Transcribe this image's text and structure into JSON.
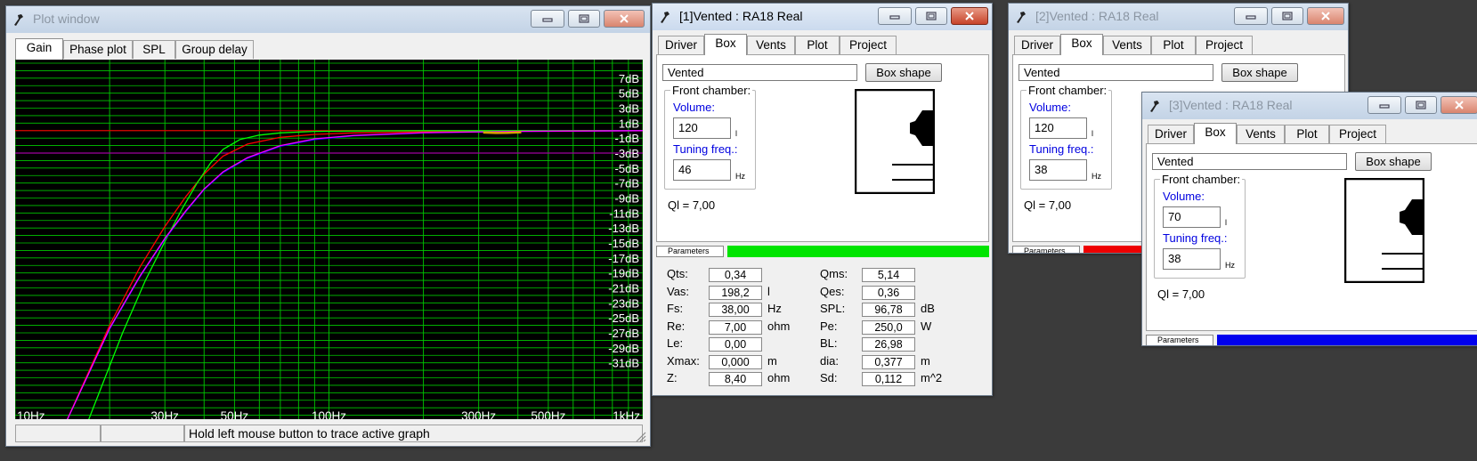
{
  "plot_window": {
    "title": "Plot window",
    "tabs": [
      "Gain",
      "Phase plot",
      "SPL",
      "Group delay"
    ],
    "selected_tab": "Gain",
    "status": "Hold left mouse button to trace active graph"
  },
  "chart_data": {
    "type": "line",
    "title": "",
    "xlabel": "",
    "ylabel": "",
    "x_scale": "log",
    "xlim": [
      10,
      1000
    ],
    "ylim": [
      -39,
      9
    ],
    "grid": true,
    "background": "#000000",
    "grid_color": "#00c800",
    "y_tick_labels": [
      "7dB",
      "5dB",
      "3dB",
      "1dB",
      "-1dB",
      "-3dB",
      "-5dB",
      "-7dB",
      "-9dB",
      "-11dB",
      "-13dB",
      "-15dB",
      "-17dB",
      "-19dB",
      "-21dB",
      "-23dB",
      "-25dB",
      "-27dB",
      "-29dB",
      "-31dB"
    ],
    "y_tick_values": [
      7,
      5,
      3,
      1,
      -1,
      -3,
      -5,
      -7,
      -9,
      -11,
      -13,
      -15,
      -17,
      -19,
      -21,
      -23,
      -25,
      -27,
      -29,
      -31
    ],
    "x_tick_labels": [
      "10Hz",
      "30Hz",
      "50Hz",
      "100Hz",
      "300Hz",
      "500Hz",
      "1kHz"
    ],
    "x_tick_values": [
      10,
      30,
      50,
      100,
      300,
      500,
      1000
    ],
    "reference_lines": [
      {
        "y": 0,
        "color": "#e00000"
      },
      {
        "y": -3,
        "color": "#a000a0"
      }
    ],
    "series": [
      {
        "color": "#ff0000",
        "x": [
          14.5,
          20,
          25,
          30,
          35,
          40,
          46,
          55,
          70,
          90,
          120,
          200,
          400,
          1000
        ],
        "y": [
          -39,
          -26,
          -18.2,
          -12.8,
          -8.8,
          -5.8,
          -3.4,
          -1.8,
          -0.9,
          -0.5,
          -0.3,
          -0.15,
          -0.05,
          0
        ]
      },
      {
        "color": "#00ff00",
        "x": [
          17,
          22,
          26,
          30,
          34,
          38,
          42,
          46,
          52,
          60,
          70,
          90,
          120,
          200,
          400,
          1000
        ],
        "y": [
          -39,
          -27,
          -20,
          -14.8,
          -10.5,
          -7,
          -4.3,
          -2.5,
          -1.2,
          -0.6,
          -0.3,
          -0.1,
          -0.05,
          0,
          0,
          0
        ]
      },
      {
        "color": "#0000ff",
        "x": [
          14.5,
          20,
          25,
          30,
          35,
          40,
          46,
          55,
          70,
          90,
          120,
          200,
          400,
          1000
        ],
        "y": [
          -39,
          -26.5,
          -19.5,
          -14.5,
          -10.8,
          -7.9,
          -5.6,
          -3.7,
          -2.1,
          -1.2,
          -0.7,
          -0.3,
          -0.1,
          0
        ]
      },
      {
        "color": "#ff00ff",
        "x": [
          14.5,
          20,
          25,
          30,
          35,
          40,
          46,
          55,
          70,
          90,
          120,
          200,
          400,
          1000
        ],
        "y": [
          -39,
          -26.4,
          -19.4,
          -14.4,
          -10.7,
          -7.8,
          -5.5,
          -3.6,
          -2.0,
          -1.1,
          -0.65,
          -0.28,
          -0.1,
          0
        ]
      },
      {
        "color": "#d8a000",
        "x": [
          310,
          340,
          370,
          410
        ],
        "y": [
          -0.25,
          -0.32,
          -0.3,
          -0.22
        ]
      }
    ]
  },
  "box_tabs": [
    "Driver",
    "Box",
    "Vents",
    "Plot",
    "Project"
  ],
  "win1": {
    "title": "[1]Vented : RA18 Real",
    "selected_tab": "Box",
    "box_type": "Vented",
    "box_shape_label": "Box shape",
    "front_chamber_label": "Front chamber:",
    "volume_label": "Volume:",
    "volume": "120",
    "volume_unit": "l",
    "tuning_label": "Tuning freq.:",
    "tuning": "46",
    "tuning_unit": "Hz",
    "ql": "Ql = 7,00",
    "params_label": "Parameters",
    "bar_color": "#00e400",
    "params_left": [
      {
        "label": "Qts:",
        "value": "0,34",
        "unit": ""
      },
      {
        "label": "Vas:",
        "value": "198,2",
        "unit": "l"
      },
      {
        "label": "Fs:",
        "value": "38,00",
        "unit": "Hz"
      },
      {
        "label": "Re:",
        "value": "7,00",
        "unit": "ohm"
      },
      {
        "label": "Le:",
        "value": "0,00",
        "unit": ""
      },
      {
        "label": "Xmax:",
        "value": "0,000",
        "unit": "m"
      },
      {
        "label": "Z:",
        "value": "8,40",
        "unit": "ohm"
      }
    ],
    "params_right": [
      {
        "label": "Qms:",
        "value": "5,14",
        "unit": ""
      },
      {
        "label": "Qes:",
        "value": "0,36",
        "unit": ""
      },
      {
        "label": "SPL:",
        "value": "96,78",
        "unit": "dB"
      },
      {
        "label": "Pe:",
        "value": "250,0",
        "unit": "W"
      },
      {
        "label": "BL:",
        "value": "26,98",
        "unit": ""
      },
      {
        "label": "dia:",
        "value": "0,377",
        "unit": "m"
      },
      {
        "label": "Sd:",
        "value": "0,112",
        "unit": "m^2"
      }
    ]
  },
  "win2": {
    "title": "[2]Vented : RA18 Real",
    "selected_tab": "Box",
    "box_type": "Vented",
    "box_shape_label": "Box shape",
    "front_chamber_label": "Front chamber:",
    "volume_label": "Volume:",
    "volume": "120",
    "volume_unit": "l",
    "tuning_label": "Tuning freq.:",
    "tuning": "38",
    "tuning_unit": "Hz",
    "ql": "Ql = 7,00",
    "params_label": "Parameters",
    "bar_color": "#ee0000"
  },
  "win3": {
    "title": "[3]Vented : RA18 Real",
    "selected_tab": "Box",
    "box_type": "Vented",
    "box_shape_label": "Box shape",
    "front_chamber_label": "Front chamber:",
    "volume_label": "Volume:",
    "volume": "70",
    "volume_unit": "l",
    "tuning_label": "Tuning freq.:",
    "tuning": "38",
    "tuning_unit": "Hz",
    "ql": "Ql = 7,00",
    "params_label": "Parameters",
    "bar_color": "#0000ee"
  }
}
